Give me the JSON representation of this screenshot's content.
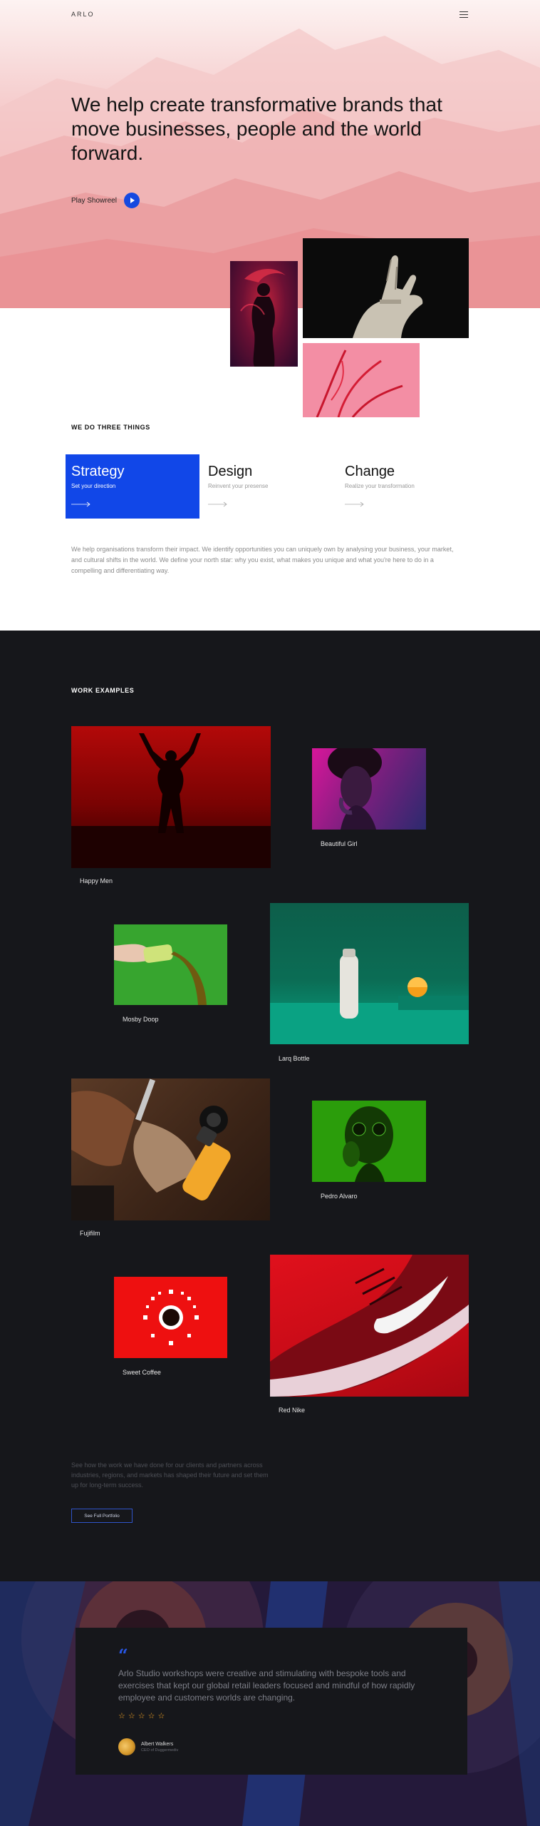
{
  "brand": {
    "logo": "ARLO"
  },
  "hero": {
    "headline": "We help create transformative brands that move businesses, people and the world forward.",
    "showreel_label": "Play Showreel"
  },
  "three_things": {
    "label": "WE DO THREE THINGS",
    "items": [
      {
        "title": "Strategy",
        "subtitle": "Set your direction"
      },
      {
        "title": "Design",
        "subtitle": "Reinvent your presense"
      },
      {
        "title": "Change",
        "subtitle": "Realize your transformation"
      }
    ],
    "intro": "We help organisations transform their impact. We identify opportunities you can uniquely own by analysing your business, your market, and cultural shifts in the world. We define your north star: why you exist, what makes you unique and what you're here to do in a compelling and differentiating way."
  },
  "work": {
    "label": "WORK EXAMPLES",
    "items": [
      {
        "caption": "Happy Men"
      },
      {
        "caption": "Beautiful Girl"
      },
      {
        "caption": "Mosby Doop"
      },
      {
        "caption": "Larq Bottle"
      },
      {
        "caption": "Fujifilm"
      },
      {
        "caption": "Pedro Alvaro"
      },
      {
        "caption": "Sweet Coffee"
      },
      {
        "caption": "Red Nike"
      }
    ],
    "description": "See how the work we have done for our clients and partners across industries, regions, and markets has shaped their future and set them up for long-term success.",
    "portfolio_button": "See Full Portfolio"
  },
  "testimonial": {
    "quote_mark": "“",
    "quote": "Arlo Studio workshops were creative and stimulating with bespoke tools and exercises that kept our global retail leaders focused and mindful of how rapidly employee and customers worlds are changing.",
    "rating": 5,
    "stars": [
      "☆",
      "☆",
      "☆",
      "☆",
      "☆"
    ],
    "author_name": "Albert Walkers",
    "author_role": "CEO of Duggermediv"
  },
  "colors": {
    "accent": "#1147e8",
    "dark_bg": "#16171b",
    "hero_pink": "#f2b7b8",
    "star": "#f5a524"
  }
}
